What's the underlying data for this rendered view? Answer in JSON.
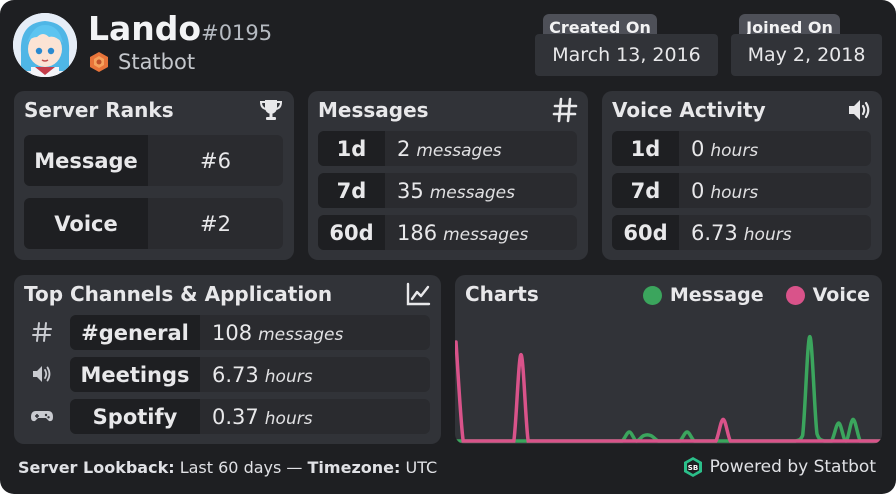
{
  "user": {
    "name": "Lando",
    "discriminator": "#0195",
    "bot_name": "Statbot"
  },
  "dates": {
    "created_label": "Created On",
    "created_value": "March 13, 2016",
    "joined_label": "Joined On",
    "joined_value": "May 2, 2018"
  },
  "server_ranks": {
    "title": "Server Ranks",
    "icon": "trophy-icon",
    "items": [
      {
        "label": "Message",
        "value": "#6"
      },
      {
        "label": "Voice",
        "value": "#2"
      }
    ]
  },
  "messages": {
    "title": "Messages",
    "icon": "hash-icon",
    "rows": [
      {
        "period": "1d",
        "value": "2",
        "unit": "messages"
      },
      {
        "period": "7d",
        "value": "35",
        "unit": "messages"
      },
      {
        "period": "60d",
        "value": "186",
        "unit": "messages"
      }
    ]
  },
  "voice_activity": {
    "title": "Voice Activity",
    "icon": "speaker-icon",
    "rows": [
      {
        "period": "1d",
        "value": "0",
        "unit": "hours"
      },
      {
        "period": "7d",
        "value": "0",
        "unit": "hours"
      },
      {
        "period": "60d",
        "value": "6.73",
        "unit": "hours"
      }
    ]
  },
  "top_channels": {
    "title": "Top Channels & Application",
    "icon": "line-chart-icon",
    "rows": [
      {
        "icon": "hash-icon",
        "name": "#general",
        "value": "108",
        "unit": "messages"
      },
      {
        "icon": "speaker-icon",
        "name": "Meetings",
        "value": "6.73",
        "unit": "hours"
      },
      {
        "icon": "gamepad-icon",
        "name": "Spotify",
        "value": "0.37",
        "unit": "hours"
      }
    ]
  },
  "charts": {
    "title": "Charts",
    "legend": [
      {
        "name": "Message",
        "color": "#3ba55d"
      },
      {
        "name": "Voice",
        "color": "#d9538a"
      }
    ]
  },
  "chart_data": {
    "type": "line",
    "x": [
      1,
      2,
      3,
      4,
      5,
      6,
      7,
      8,
      9,
      10,
      11,
      12,
      13,
      14,
      15,
      16,
      17,
      18,
      19,
      20,
      21,
      22,
      23,
      24,
      25,
      26,
      27,
      28,
      29,
      30,
      31,
      32,
      33,
      34,
      35,
      36,
      37,
      38,
      39,
      40,
      41,
      42,
      43,
      44,
      45,
      46,
      47,
      48,
      49,
      50,
      51,
      52,
      53,
      54,
      55,
      56,
      57,
      58,
      59,
      60
    ],
    "series": [
      {
        "name": "Message",
        "color": "#3ba55d",
        "values": [
          0,
          0,
          0,
          0,
          0,
          0,
          0,
          0,
          0,
          0,
          0,
          0,
          0,
          0,
          0,
          0,
          0,
          0,
          0,
          0,
          0,
          0,
          0,
          0,
          5,
          0,
          3,
          3,
          0,
          0,
          0,
          0,
          5,
          0,
          0,
          0,
          0,
          0,
          0,
          0,
          0,
          0,
          0,
          0,
          0,
          0,
          0,
          0,
          3,
          58,
          4,
          0,
          0,
          10,
          0,
          12,
          0,
          0,
          0,
          0
        ]
      },
      {
        "name": "Voice",
        "color": "#d9538a",
        "values": [
          55,
          0,
          0,
          0,
          0,
          0,
          0,
          0,
          0,
          48,
          0,
          0,
          0,
          0,
          0,
          0,
          0,
          0,
          0,
          0,
          0,
          0,
          0,
          0,
          0,
          0,
          0,
          0,
          0,
          0,
          0,
          0,
          0,
          0,
          0,
          0,
          0,
          12,
          0,
          0,
          0,
          0,
          0,
          0,
          0,
          0,
          0,
          0,
          0,
          0,
          0,
          0,
          0,
          0,
          0,
          0,
          0,
          0,
          0,
          0
        ]
      }
    ],
    "xlabel": "",
    "ylabel": "",
    "grid": false,
    "legend_placement": "top-right"
  },
  "footer": {
    "lookback_label": "Server Lookback:",
    "lookback_value": "Last 60 days",
    "separator": "—",
    "timezone_label": "Timezone:",
    "timezone_value": "UTC",
    "powered_by": "Powered by Statbot"
  }
}
